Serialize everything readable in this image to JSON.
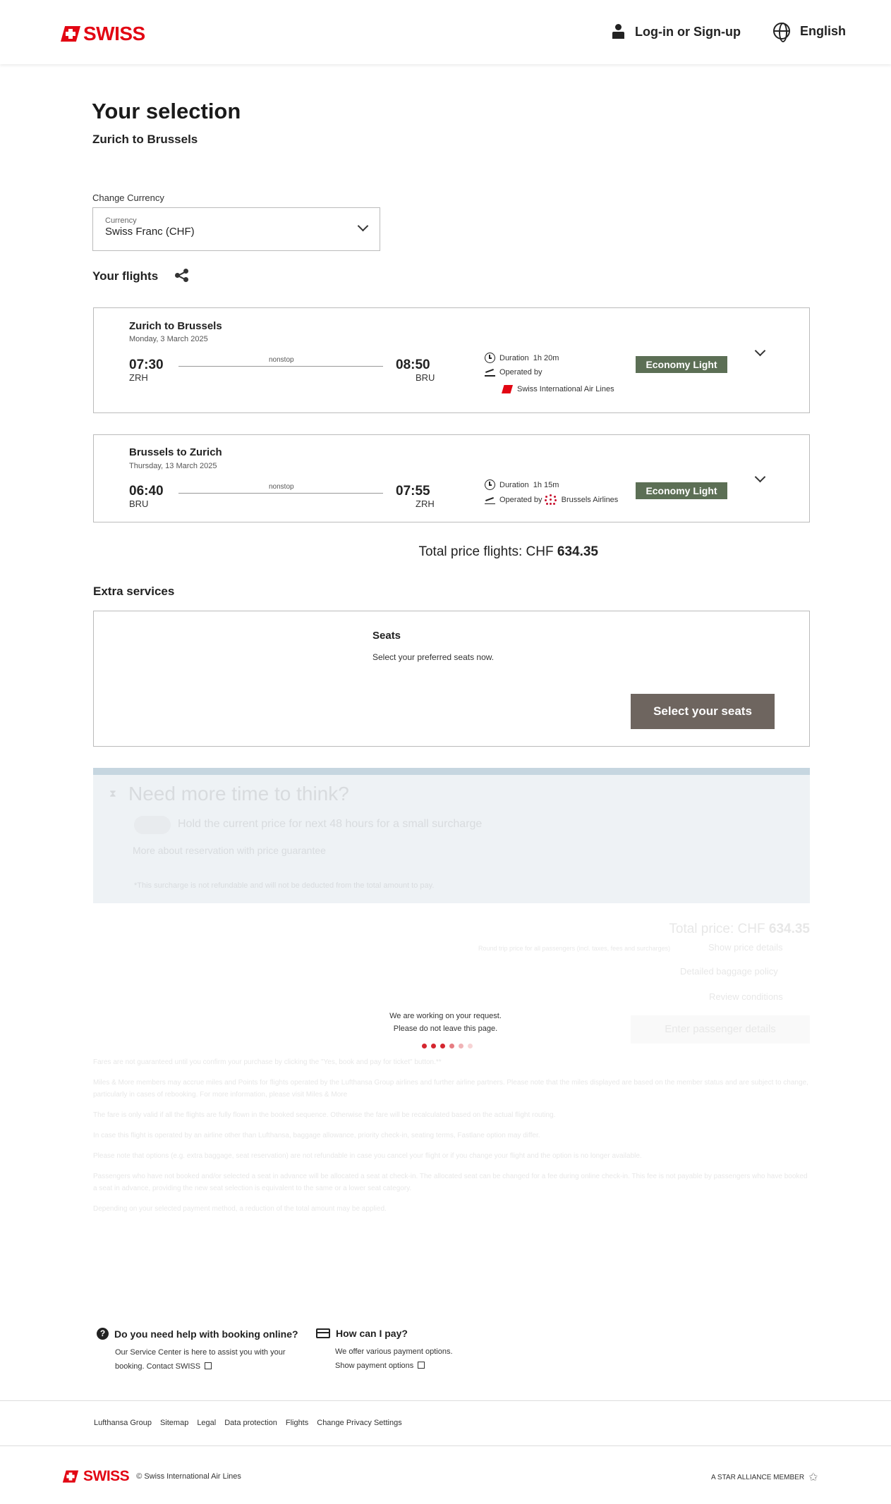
{
  "header": {
    "brand": "SWISS",
    "login_label": "Log-in or Sign-up",
    "language_label": "English"
  },
  "page": {
    "title": "Your selection",
    "route": "Zurich to Brussels"
  },
  "currency": {
    "section_label": "Change Currency",
    "field_label": "Currency",
    "value": "Swiss Franc (CHF)"
  },
  "flights": {
    "title": "Your flights",
    "items": [
      {
        "route": "Zurich to Brussels",
        "date": "Monday, 3 March 2025",
        "dep_time": "07:30",
        "dep_code": "ZRH",
        "arr_time": "08:50",
        "arr_code": "BRU",
        "stops": "nonstop",
        "duration_label": "Duration",
        "duration": "1h 20m",
        "operated_label": "Operated by",
        "operator": "Swiss International Air Lines",
        "fare": "Economy Light"
      },
      {
        "route": "Brussels to Zurich",
        "date": "Thursday, 13 March 2025",
        "dep_time": "06:40",
        "dep_code": "BRU",
        "arr_time": "07:55",
        "arr_code": "ZRH",
        "stops": "nonstop",
        "duration_label": "Duration",
        "duration": "1h 15m",
        "operated_label": "Operated by",
        "operator": "Brussels Airlines",
        "fare": "Economy Light"
      }
    ],
    "total_label": "Total price flights: CHF",
    "total_value": "634.35"
  },
  "extras": {
    "title": "Extra services",
    "seats_title": "Seats",
    "seats_text": "Select your preferred seats now.",
    "seats_button": "Select your seats"
  },
  "hold": {
    "title": "Need more time to think?",
    "toggle_text": "Hold the current price for next 48 hours for a small surcharge",
    "more_link": "More about reservation with price guarantee",
    "note": "*This surcharge is not refundable and will not be deducted from the total amount to pay."
  },
  "summary": {
    "total_label": "Total price: CHF",
    "total_value": "634.35",
    "round_text": "Round trip price for all passengers (incl. taxes, fees and surcharges)",
    "price_details": "Show price details",
    "baggage": "Detailed baggage policy",
    "conditions": "Review conditions",
    "next_button": "Enter passenger details"
  },
  "loading": {
    "line1": "We are working on your request.",
    "line2": "Please do not leave this page."
  },
  "notes": [
    "Fares are not guaranteed until you confirm your purchase by clicking the \"Yes, book and pay for ticket\" button.**",
    "Miles & More members may accrue miles and Points for flights operated by the Lufthansa Group airlines and further airline partners. Please note that the miles displayed are based on the member status and are subject to change, particularly in cases of rebooking. For more information, please visit Miles & More",
    "The fare is only valid if all the flights are fully flown in the booked sequence. Otherwise the fare will be recalculated based on the actual flight routing.",
    "In case this flight is operated by an airline other than Lufthansa, baggage allowance, priority check-in, seating terms, Fastlane option may differ.",
    "Please note that options (e.g. extra baggage, seat reservation) are not refundable in case you cancel your flight or if you change your flight and the option is no longer available.",
    "Passengers who have not booked and/or selected a seat in advance will be allocated a seat at check-in. The allocated seat can be changed for a fee during online check-in. This fee is not payable by passengers who have booked a seat in advance, providing the new seat selection is equivalent to the same or a lower seat category.",
    "Depending on your selected payment method, a reduction of the total amount may be applied."
  ],
  "help": {
    "booking_title": "Do you need help with booking online?",
    "booking_text1": "Our Service Center is here to assist you with your",
    "booking_text2": "booking. Contact SWISS",
    "pay_title": "How can I pay?",
    "pay_text": "We offer various payment options.",
    "pay_link": "Show payment options"
  },
  "footer": {
    "links": [
      "Lufthansa Group",
      "Sitemap",
      "Legal",
      "Data protection",
      "Flights",
      "Change Privacy Settings"
    ],
    "copyright": "© Swiss International Air Lines",
    "alliance": "A STAR ALLIANCE MEMBER"
  },
  "colors": {
    "brand_red": "#e20613",
    "fare_badge": "#5c6f55",
    "seat_button": "#6e655f"
  }
}
